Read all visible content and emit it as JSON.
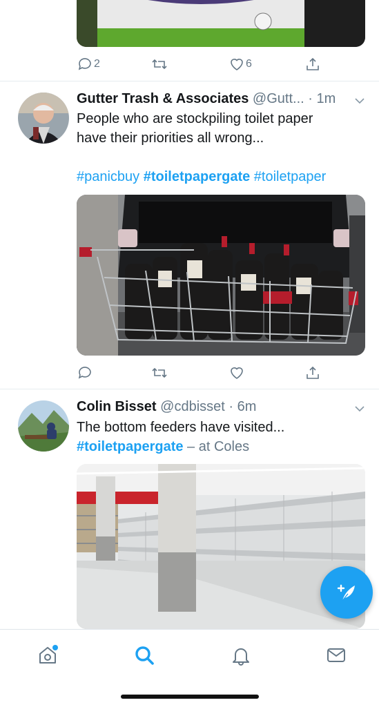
{
  "tweets": [
    {
      "actions": {
        "reply_count": "2",
        "retweet_count": "",
        "like_count": "6"
      }
    },
    {
      "author_name": "Gutter Trash & Associates",
      "handle": "@Gutt...",
      "separator": " · ",
      "time": "1m",
      "text_line1": "People who are stockpiling toilet paper",
      "text_line2": "have their priorities all wrong...",
      "hashtags": [
        "#panicbuy",
        "#toiletpapergate",
        "#toiletpaper"
      ],
      "actions": {
        "reply_count": "",
        "retweet_count": "",
        "like_count": ""
      }
    },
    {
      "author_name": "Colin Bisset",
      "handle": "@cdbisset",
      "separator": " · ",
      "time": "6m",
      "text_line1": "The bottom feeders have visited...",
      "hashtag": "#toiletpapergate",
      "location_text": " – at Coles"
    }
  ],
  "tabs": [
    "home-icon",
    "search-icon",
    "notifications-icon",
    "messages-icon"
  ],
  "colors": {
    "accent": "#1da1f2",
    "text": "#14171a",
    "muted": "#657786"
  }
}
